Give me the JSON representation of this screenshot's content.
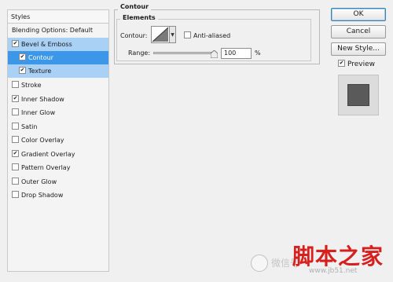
{
  "styles_panel": {
    "header": "Styles",
    "items": [
      {
        "label": "Blending Options: Default",
        "checkbox": false
      },
      {
        "label": "Bevel & Emboss",
        "checkbox": true,
        "checked": true
      },
      {
        "label": "Contour",
        "checkbox": true,
        "checked": true
      },
      {
        "label": "Texture",
        "checkbox": true,
        "checked": true
      },
      {
        "label": "Stroke",
        "checkbox": true,
        "checked": false
      },
      {
        "label": "Inner Shadow",
        "checkbox": true,
        "checked": true
      },
      {
        "label": "Inner Glow",
        "checkbox": true,
        "checked": false
      },
      {
        "label": "Satin",
        "checkbox": true,
        "checked": false
      },
      {
        "label": "Color Overlay",
        "checkbox": true,
        "checked": false
      },
      {
        "label": "Gradient Overlay",
        "checkbox": true,
        "checked": true
      },
      {
        "label": "Pattern Overlay",
        "checkbox": true,
        "checked": false
      },
      {
        "label": "Outer Glow",
        "checkbox": true,
        "checked": false
      },
      {
        "label": "Drop Shadow",
        "checkbox": true,
        "checked": false
      }
    ]
  },
  "contour_panel": {
    "title": "Contour",
    "elements_title": "Elements",
    "contour_label": "Contour:",
    "anti_aliased_label": "Anti-aliased",
    "range_label": "Range:",
    "range_value": "100",
    "range_unit": "%"
  },
  "buttons": {
    "ok": "OK",
    "cancel": "Cancel",
    "new_style": "New Style...",
    "preview_label": "Preview"
  },
  "watermark": {
    "left_text": "微信号",
    "title": "脚本之家",
    "subtitle": "www.jb51.net"
  }
}
